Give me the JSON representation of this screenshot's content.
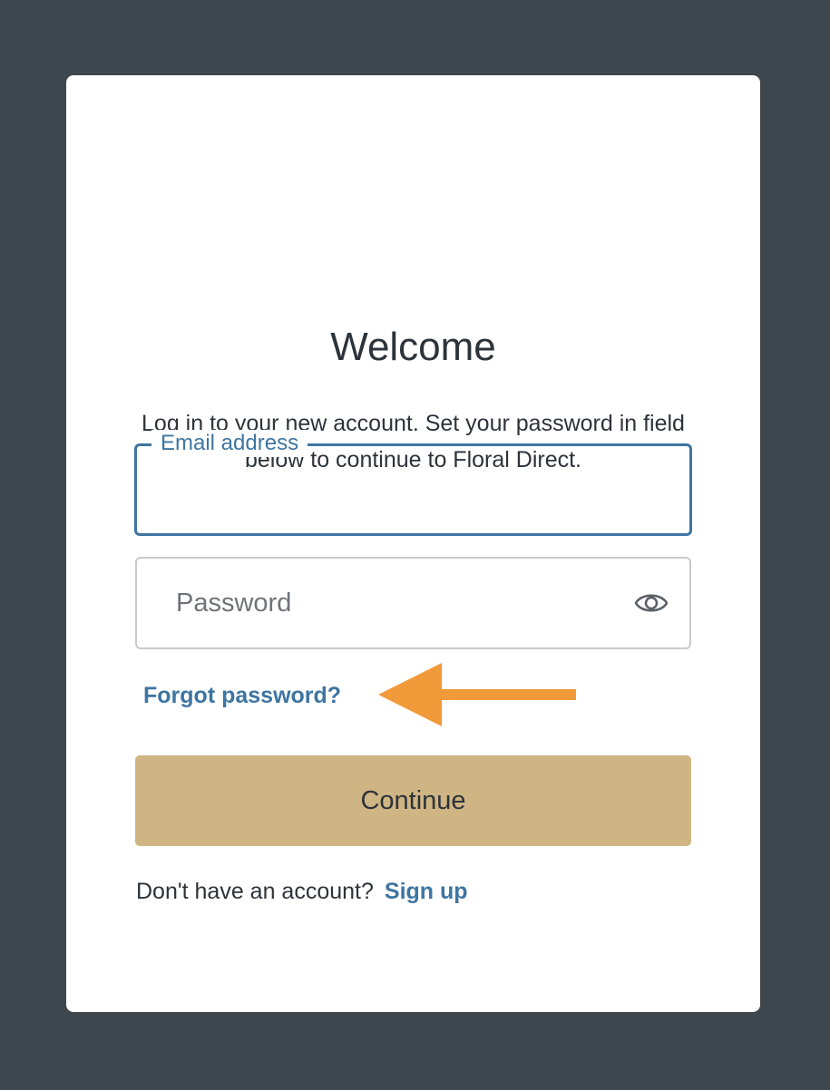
{
  "login": {
    "title": "Welcome",
    "subtitle": "Log in to your new account. Set your password in field below to continue to Floral Direct.",
    "email": {
      "label": "Email address",
      "value": ""
    },
    "password": {
      "placeholder": "Password",
      "value": "",
      "toggle_icon": "eye-icon"
    },
    "forgot_label": "Forgot password?",
    "continue_label": "Continue",
    "signup_prompt": "Don't have an account?",
    "signup_label": "Sign up"
  },
  "annotation": {
    "icon": "arrow-left-icon",
    "color": "#f09a3a"
  },
  "colors": {
    "background": "#3d474d",
    "card": "#ffffff",
    "accent": "#3e75a1",
    "button": "#d0b584",
    "text": "#2d333a"
  }
}
